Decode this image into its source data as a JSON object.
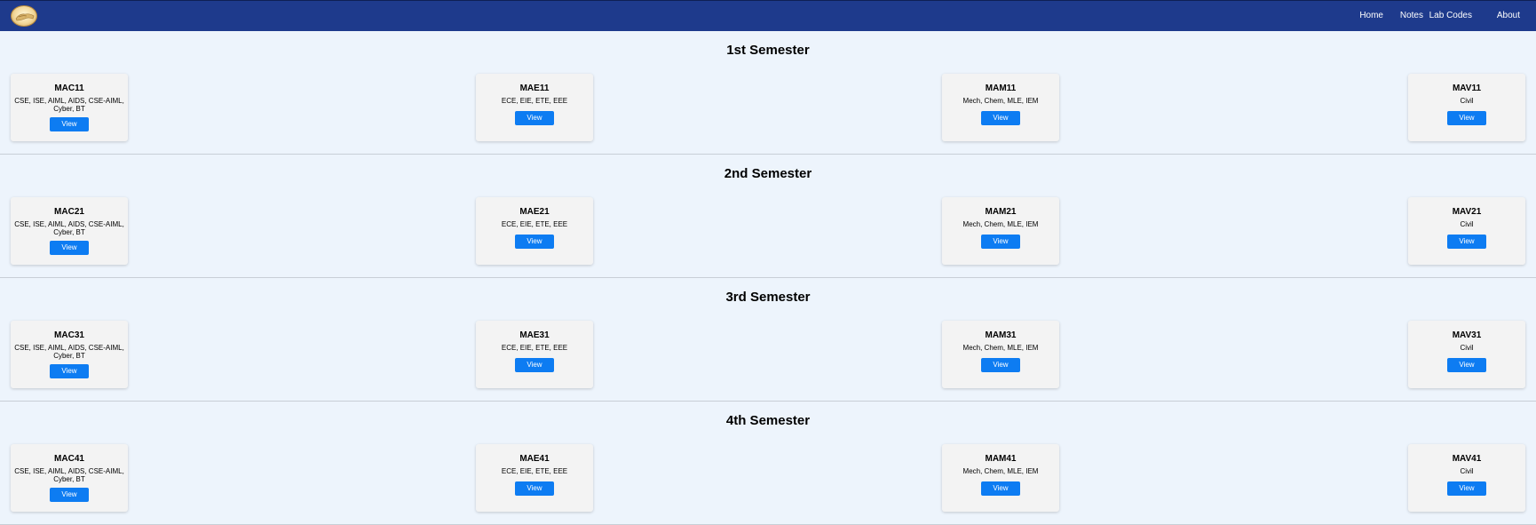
{
  "nav": {
    "links": [
      "Home",
      "Notes",
      "Lab Codes",
      "About"
    ]
  },
  "view_label": "View",
  "colors": {
    "navbar": "#1e3a8c",
    "page_background": "#edf4fc",
    "card_background": "#f3f3f3",
    "button": "#0d7cf2"
  },
  "semesters": [
    {
      "title": "1st Semester",
      "courses": [
        {
          "code": "MAC11",
          "branches": "CSE, ISE, AIML, AIDS, CSE-AIML, Cyber, BT"
        },
        {
          "code": "MAE11",
          "branches": "ECE, EIE, ETE, EEE"
        },
        {
          "code": "MAM11",
          "branches": "Mech, Chem, MLE, IEM"
        },
        {
          "code": "MAV11",
          "branches": "Civil"
        }
      ]
    },
    {
      "title": "2nd Semester",
      "courses": [
        {
          "code": "MAC21",
          "branches": "CSE, ISE, AIML, AIDS, CSE-AIML, Cyber, BT"
        },
        {
          "code": "MAE21",
          "branches": "ECE, EIE, ETE, EEE"
        },
        {
          "code": "MAM21",
          "branches": "Mech, Chem, MLE, IEM"
        },
        {
          "code": "MAV21",
          "branches": "Civil"
        }
      ]
    },
    {
      "title": "3rd Semester",
      "courses": [
        {
          "code": "MAC31",
          "branches": "CSE, ISE, AIML, AIDS, CSE-AIML, Cyber, BT"
        },
        {
          "code": "MAE31",
          "branches": "ECE, EIE, ETE, EEE"
        },
        {
          "code": "MAM31",
          "branches": "Mech, Chem, MLE, IEM"
        },
        {
          "code": "MAV31",
          "branches": "Civil"
        }
      ]
    },
    {
      "title": "4th Semester",
      "courses": [
        {
          "code": "MAC41",
          "branches": "CSE, ISE, AIML, AIDS, CSE-AIML, Cyber, BT"
        },
        {
          "code": "MAE41",
          "branches": "ECE, EIE, ETE, EEE"
        },
        {
          "code": "MAM41",
          "branches": "Mech, Chem, MLE, IEM"
        },
        {
          "code": "MAV41",
          "branches": "Civil"
        }
      ]
    }
  ]
}
